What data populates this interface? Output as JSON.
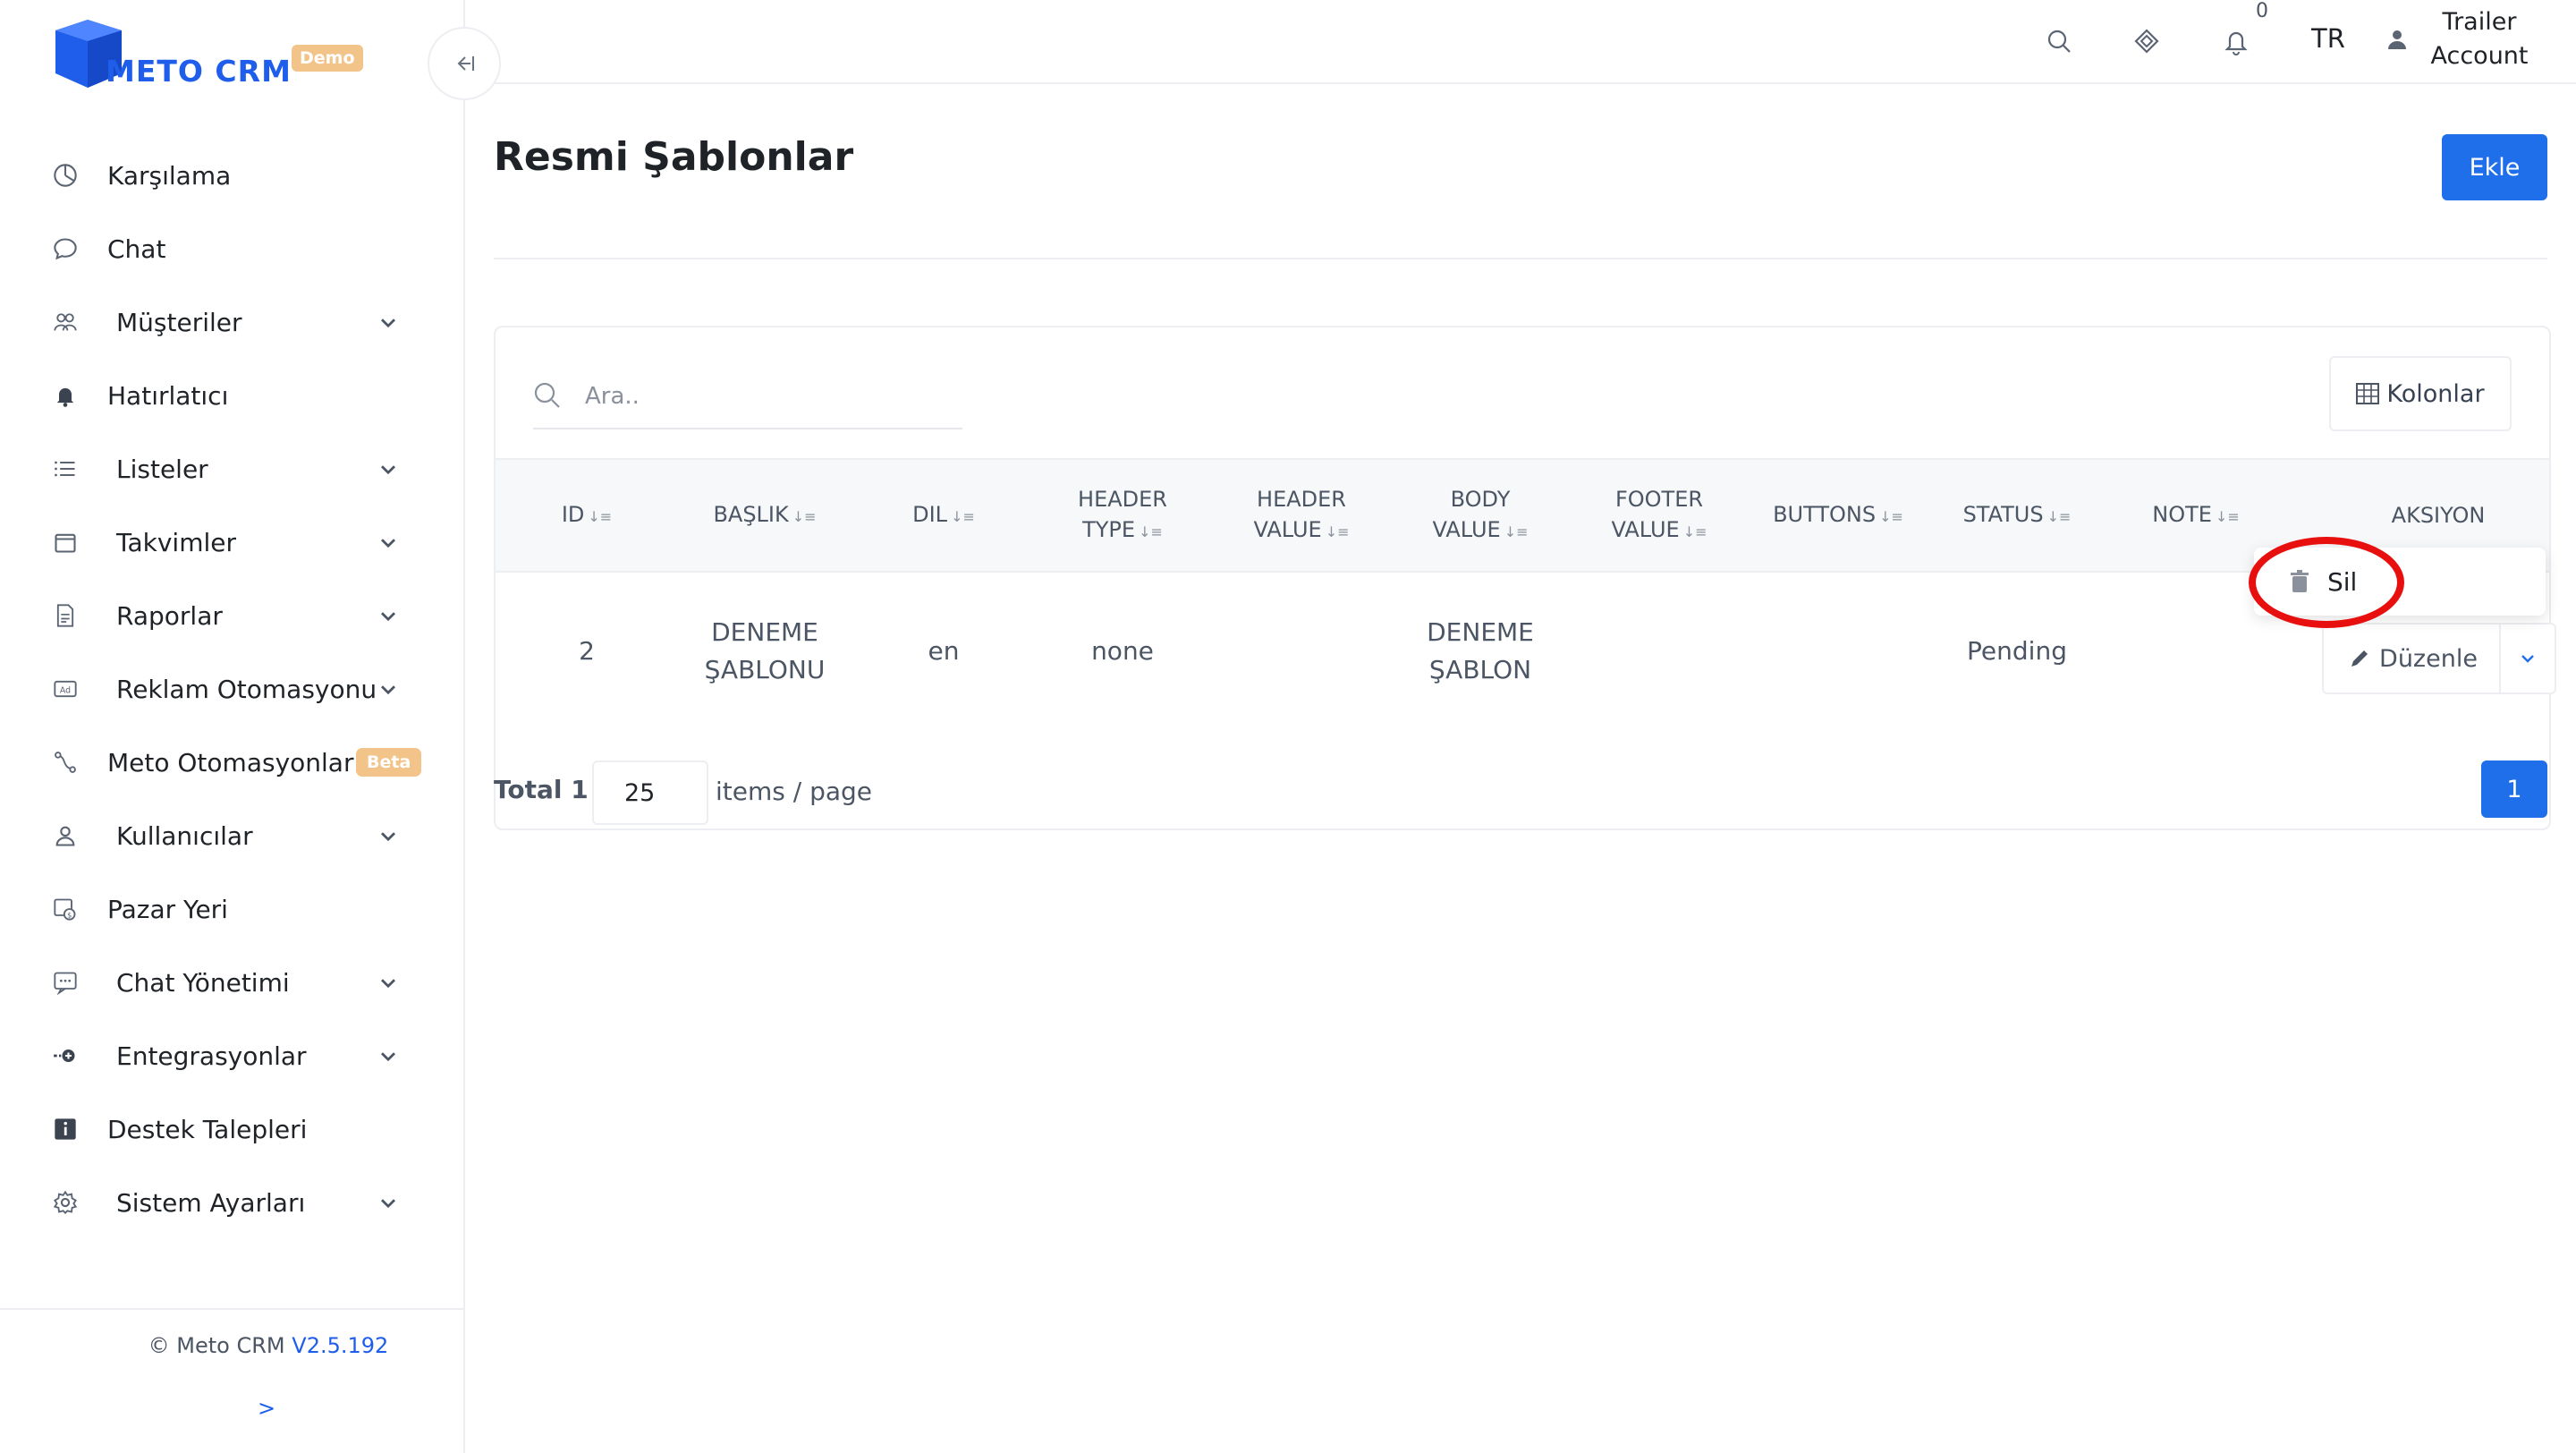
{
  "app": {
    "logo_text": "METO CRM",
    "demo_badge": "Demo",
    "brand_color": "#1f5eea",
    "accent_color": "#1f6feb"
  },
  "sidebar": {
    "items": [
      {
        "label": "Karşılama",
        "icon": "dashboard-icon",
        "has_chevron": false
      },
      {
        "label": "Chat",
        "icon": "chat-bubble-icon",
        "has_chevron": false
      },
      {
        "label": "Müşteriler",
        "icon": "users-icon",
        "has_chevron": true
      },
      {
        "label": "Hatırlatıcı",
        "icon": "bell-icon",
        "has_chevron": false
      },
      {
        "label": "Listeler",
        "icon": "list-icon",
        "has_chevron": true
      },
      {
        "label": "Takvimler",
        "icon": "calendar-icon",
        "has_chevron": true
      },
      {
        "label": "Raporlar",
        "icon": "report-icon",
        "has_chevron": true
      },
      {
        "label": "Reklam Otomasyonu",
        "icon": "ad-icon",
        "has_chevron": true
      },
      {
        "label": "Meto Otomasyonları",
        "icon": "automation-icon",
        "has_chevron": false,
        "badge": "Beta"
      },
      {
        "label": "Kullanıcılar",
        "icon": "user-icon",
        "has_chevron": true
      },
      {
        "label": "Pazar Yeri",
        "icon": "marketplace-icon",
        "has_chevron": false
      },
      {
        "label": "Chat Yönetimi",
        "icon": "chat-settings-icon",
        "has_chevron": true
      },
      {
        "label": "Entegrasyonlar",
        "icon": "integration-icon",
        "has_chevron": true
      },
      {
        "label": "Destek Talepleri",
        "icon": "info-icon",
        "has_chevron": false
      },
      {
        "label": "Sistem Ayarları",
        "icon": "gear-icon",
        "has_chevron": true
      }
    ],
    "footer": {
      "copyright": "© Meto CRM",
      "version": "V2.5.192",
      "expand_label": ">"
    }
  },
  "topbar": {
    "notification_count": "0",
    "language": "TR",
    "account_name": "Trailer Account"
  },
  "page": {
    "title": "Resmi Şablonlar",
    "add_button": "Ekle"
  },
  "table": {
    "search_placeholder": "Ara..",
    "columns_button": "Kolonlar",
    "headers": [
      {
        "label": "ID",
        "sortable": true
      },
      {
        "label": "BAŞLIK",
        "sortable": true
      },
      {
        "label": "DIL",
        "sortable": true
      },
      {
        "label": "HEADER TYPE",
        "sortable": true
      },
      {
        "label": "HEADER VALUE",
        "sortable": true
      },
      {
        "label": "BODY VALUE",
        "sortable": true
      },
      {
        "label": "FOOTER VALUE",
        "sortable": true
      },
      {
        "label": "BUTTONS",
        "sortable": true
      },
      {
        "label": "STATUS",
        "sortable": true
      },
      {
        "label": "NOTE",
        "sortable": true
      },
      {
        "label": "AKSIYON",
        "sortable": false
      }
    ],
    "rows": [
      {
        "id": "2",
        "baslik": "DENEME ŞABLONU",
        "dil": "en",
        "header_type": "none",
        "header_value": "",
        "body_value": "DENEME ŞABLON",
        "footer_value": "",
        "buttons": "",
        "status": "Pending",
        "note": "",
        "action_edit": "Düzenle"
      }
    ],
    "dropdown_item": "Sil",
    "highlight_color": "#e8100f",
    "pagination": {
      "total_label": "Total 1 ,",
      "page_size": "25",
      "suffix": "items / page",
      "current_page": "1"
    }
  }
}
